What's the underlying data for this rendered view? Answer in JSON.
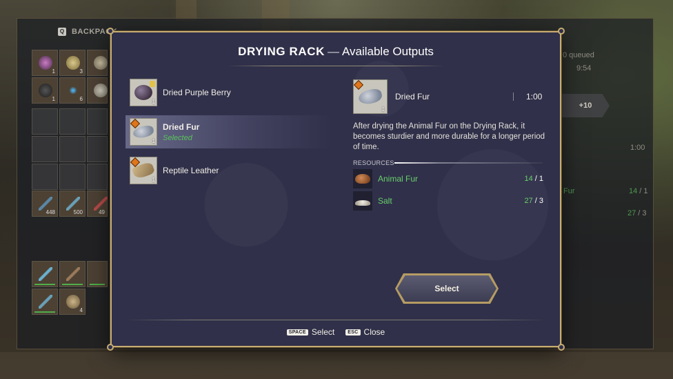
{
  "background": {
    "inventory_tabs": [
      {
        "key": "Q",
        "label": "BACKPACK"
      }
    ],
    "slot_counts": [
      "1",
      "3",
      "1",
      "6",
      "448",
      "500",
      "49",
      "4"
    ],
    "craft_panel": {
      "title": "DRYING RACK",
      "queued_text": "0 queued",
      "queue_time": "9:54",
      "add_button": "+10",
      "time": "1:00",
      "res1_name": "Fur",
      "res1_have": "14",
      "res1_need": "1",
      "res2_have": "27",
      "res2_need": "3"
    }
  },
  "modal": {
    "station": "DRYING RACK",
    "separator": "—",
    "subtitle": "Available Outputs"
  },
  "outputs": [
    {
      "name": "Dried Purple Berry",
      "sub": "",
      "tier": "1",
      "icon": "purple-berry-icon"
    },
    {
      "name": "Dried Fur",
      "sub": "Selected",
      "tier": "1",
      "icon": "dried-fur-icon"
    },
    {
      "name": "Reptile Leather",
      "sub": "",
      "tier": "1",
      "icon": "reptile-leather-icon"
    }
  ],
  "detail": {
    "name": "Dried Fur",
    "tier": "1",
    "time": "1:00",
    "description": "After drying the Animal Fur on the Drying Rack, it becomes sturdier and more durable for a longer period of time.",
    "resources_label": "RESOURCES",
    "resources": [
      {
        "name": "Animal Fur",
        "have": "14",
        "need": "1",
        "icon": "animal-fur-icon"
      },
      {
        "name": "Salt",
        "have": "27",
        "need": "3",
        "icon": "salt-icon"
      }
    ]
  },
  "select_button": "Select",
  "footer": {
    "select_key": "SPACE",
    "select_label": "Select",
    "close_key": "ESC",
    "close_label": "Close"
  },
  "colors": {
    "modal_bg": "#30304a",
    "gold_border": "#c8ad72",
    "green_ok": "#68d06a",
    "warn_orange": "#e0751c"
  }
}
